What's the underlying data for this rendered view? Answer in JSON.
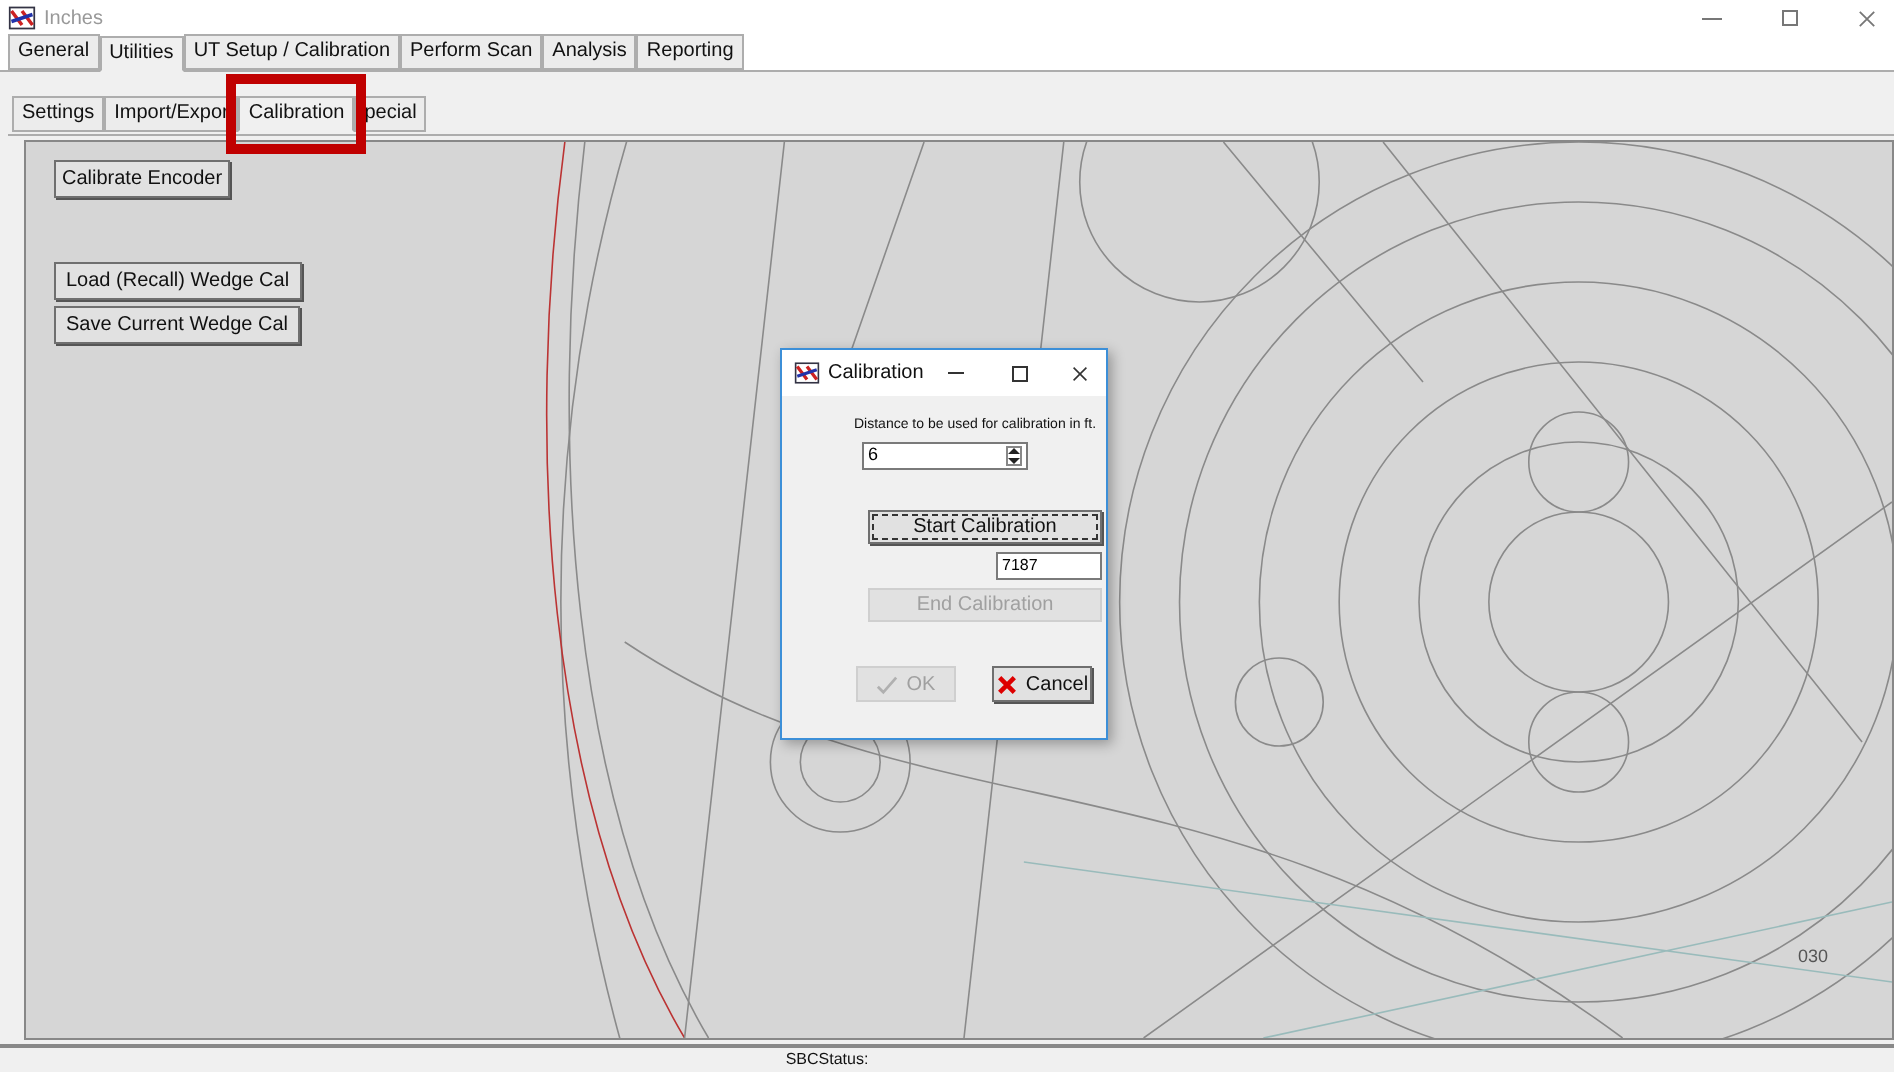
{
  "window": {
    "title": "Inches"
  },
  "main_tabs": [
    {
      "label": "General",
      "selected": false
    },
    {
      "label": "Utilities",
      "selected": true
    },
    {
      "label": "UT Setup / Calibration",
      "selected": false
    },
    {
      "label": "Perform Scan",
      "selected": false
    },
    {
      "label": "Analysis",
      "selected": false
    },
    {
      "label": "Reporting",
      "selected": false
    }
  ],
  "sub_tabs": [
    {
      "label": "Settings",
      "selected": false,
      "highlighted": false
    },
    {
      "label": "Import/Expor",
      "selected": false,
      "highlighted": false
    },
    {
      "label": "Calibration",
      "selected": true,
      "highlighted": true
    },
    {
      "label": "pecial",
      "selected": false,
      "highlighted": false
    }
  ],
  "panel_buttons": [
    {
      "label": "Calibrate Encoder"
    },
    {
      "label": "Load (Recall) Wedge Cal"
    },
    {
      "label": "Save Current Wedge Cal"
    }
  ],
  "drawing_label": "030",
  "dialog": {
    "title": "Calibration",
    "prompt": "Distance to be used for calibration in ft.",
    "distance": "6",
    "start_button": {
      "label": "Start Calibration",
      "focused": true
    },
    "count": "7187",
    "end_button": {
      "label": "End Calibration",
      "disabled": true
    },
    "ok_button": {
      "label": "OK",
      "disabled": true
    },
    "cancel_button": {
      "label": "Cancel",
      "disabled": false
    }
  },
  "status_bar": {
    "text": "SBCStatus:"
  }
}
